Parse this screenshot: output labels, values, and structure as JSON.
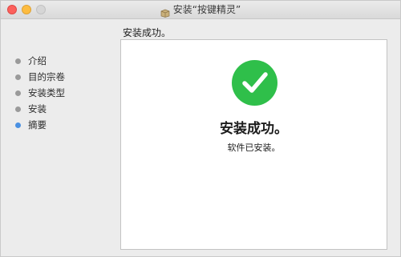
{
  "window": {
    "title": "安装“按键精灵”"
  },
  "header": {
    "section_title": "安装成功。"
  },
  "sidebar": {
    "steps": [
      {
        "label": "介绍",
        "active": false
      },
      {
        "label": "目的宗卷",
        "active": false
      },
      {
        "label": "安装类型",
        "active": false
      },
      {
        "label": "安装",
        "active": false
      },
      {
        "label": "摘要",
        "active": true
      }
    ]
  },
  "main": {
    "status_icon": "checkmark-circle-icon",
    "status_color": "#2fbf4a",
    "title": "安装成功。",
    "message": "软件已安装。"
  },
  "colors": {
    "active_step": "#4a90e2",
    "inactive_step": "#9a9a9a",
    "close": "#fc605c",
    "minimize": "#fdbc40",
    "zoom_disabled": "#d6d6d6"
  }
}
